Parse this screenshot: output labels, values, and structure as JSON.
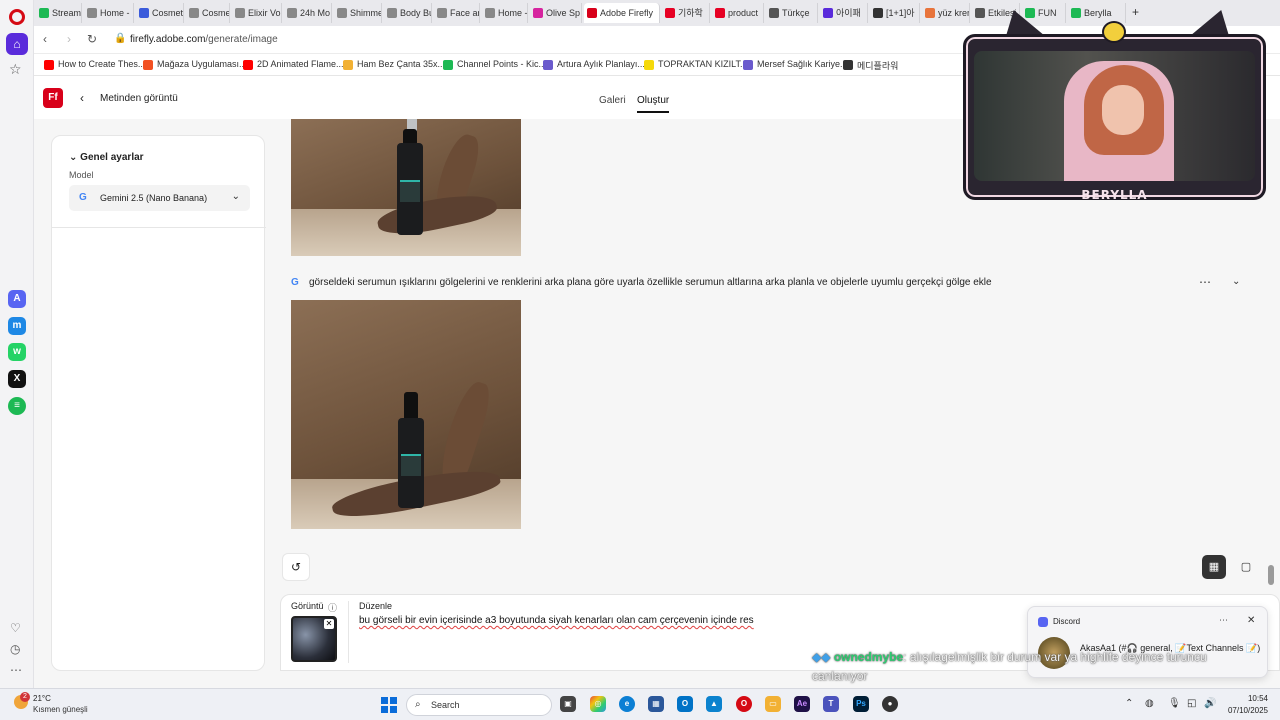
{
  "browser": {
    "tabs": [
      {
        "label": "Stream",
        "color": "#1db954"
      },
      {
        "label": "Home -",
        "color": "#888888"
      },
      {
        "label": "Cosmet",
        "color": "#3b5bdb"
      },
      {
        "label": "Cosmeti",
        "color": "#888888"
      },
      {
        "label": "Elixir Vo",
        "color": "#888888"
      },
      {
        "label": "24h Mo",
        "color": "#888888"
      },
      {
        "label": "Shimme",
        "color": "#888888"
      },
      {
        "label": "Body Bu",
        "color": "#888888"
      },
      {
        "label": "Face anc",
        "color": "#888888"
      },
      {
        "label": "Home -",
        "color": "#888888"
      },
      {
        "label": "Olive Sp",
        "color": "#d6249f"
      },
      {
        "label": "Adobe Firefly",
        "color": "#d8001a"
      },
      {
        "label": "기하학",
        "color": "#e60023"
      },
      {
        "label": "product",
        "color": "#e60023"
      },
      {
        "label": "Türkçe",
        "color": "#555555"
      },
      {
        "label": "아이패",
        "color": "#5a2bdb"
      },
      {
        "label": "[1+1]아",
        "color": "#333333"
      },
      {
        "label": "yüz krer",
        "color": "#e8743b"
      },
      {
        "label": "Etkileşi",
        "color": "#555555"
      },
      {
        "label": "FUN",
        "color": "#1db954"
      },
      {
        "label": "Berylla",
        "color": "#1db954"
      }
    ],
    "new_tab": "+",
    "url_prefix": "firefly.adobe.com",
    "url_path": "/generate/image",
    "bookmarks": [
      {
        "label": "How to Create Thes...",
        "color": "#ff0000"
      },
      {
        "label": "Mağaza Uygulaması...",
        "color": "#f25022"
      },
      {
        "label": "2D Animated Flame...",
        "color": "#ff0000"
      },
      {
        "label": "Ham Bez Çanta 35x...",
        "color": "#f2b134"
      },
      {
        "label": "Channel Points - Kic...",
        "color": "#1db954"
      },
      {
        "label": "Artura Aylık Planlayı...",
        "color": "#6a5acd"
      },
      {
        "label": "TOPRAKTAN KIZILT...",
        "color": "#f5d90a"
      },
      {
        "label": "Mersef Sağlık Kariye...",
        "color": "#6a5acd"
      },
      {
        "label": "메디플라워",
        "color": "#333333"
      }
    ]
  },
  "firefly": {
    "logo": "Ff",
    "back_title": "Metinden görüntü",
    "nav": [
      "Galeri",
      "Oluştur"
    ],
    "panel": {
      "heading": "Genel ayarlar",
      "model_label": "Model",
      "model_value": "Gemini 2.5 (Nano Banana)"
    },
    "prompt": "görseldeki serumun ışıklarını gölgelerini ve renklerini arka plana göre uyarla özellikle serumun altlarına arka planla ve objelerle uyumlu gerçekçi gölge ekle",
    "composer": {
      "image_label": "Görüntü",
      "edit_label": "Düzenle",
      "text": "bu görseli bir evin içerisinde a3 boyutunda siyah kenarları olan cam çerçevenin içinde res"
    }
  },
  "stream": {
    "streamer_name": "BERYLLA",
    "chat_user": "ownedmybe",
    "chat_message": ": alışılagelmişlik bir durum var ya highlife deyince turuncu",
    "chat_message_2": "canlanıyor"
  },
  "discord": {
    "title": "Discord",
    "message": "AkasAa1 (#🎧 general, 📝Text Channels 📝)"
  },
  "taskbar": {
    "weather_badge": "2",
    "temp": "21°C",
    "condition": "Kısmen güneşli",
    "search": "Search",
    "time": "10:54",
    "date": "07/10/2025"
  }
}
